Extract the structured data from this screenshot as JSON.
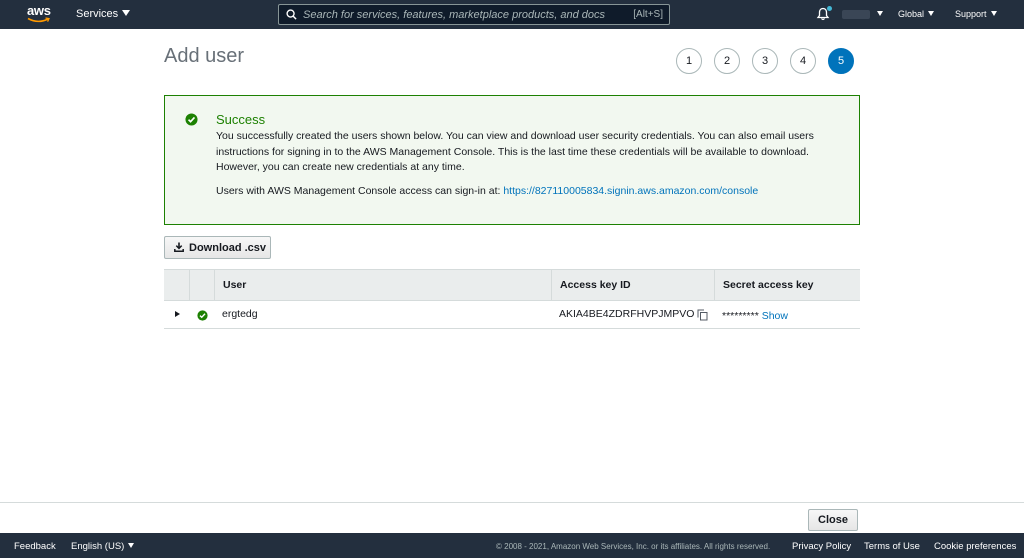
{
  "topnav": {
    "logo_text": "aws",
    "services_label": "Services",
    "search_placeholder": "Search for services, features, marketplace products, and docs",
    "search_hotkey": "[Alt+S]",
    "region_label": "Global",
    "support_label": "Support"
  },
  "page": {
    "title": "Add user",
    "steps": [
      "1",
      "2",
      "3",
      "4",
      "5"
    ],
    "active_step": 5
  },
  "success": {
    "title": "Success",
    "body": "You successfully created the users shown below. You can view and download user security credentials. You can also email users instructions for signing in to the AWS Management Console. This is the last time these credentials will be available to download. However, you can create new credentials at any time.",
    "signin_prefix": "Users with AWS Management Console access can sign-in at: ",
    "signin_url": "https://827110005834.signin.aws.amazon.com/console"
  },
  "download_button": "Download .csv",
  "table": {
    "headers": [
      "User",
      "Access key ID",
      "Secret access key"
    ],
    "rows": [
      {
        "user": "ergtedg",
        "access_key_id": "AKIA4BE4ZDRFHVPJMPVO",
        "secret_mask": "*********",
        "show_label": "Show"
      }
    ]
  },
  "actionbar": {
    "close_label": "Close"
  },
  "footer": {
    "feedback": "Feedback",
    "language": "English (US)",
    "copyright": "© 2008 - 2021, Amazon Web Services, Inc. or its affiliates. All rights reserved.",
    "privacy": "Privacy Policy",
    "terms": "Terms of Use",
    "cookies": "Cookie preferences"
  },
  "colors": {
    "nav_bg": "#232f3e",
    "success_green": "#1d8102",
    "success_bg": "#f2f8f0",
    "link_blue": "#0073bb",
    "active_step": "#0073bb"
  },
  "icons": [
    "aws-smile-icon",
    "caret-down-icon",
    "search-icon",
    "bell-icon",
    "check-circle-icon",
    "download-icon",
    "expand-caret-icon",
    "copy-icon"
  ]
}
